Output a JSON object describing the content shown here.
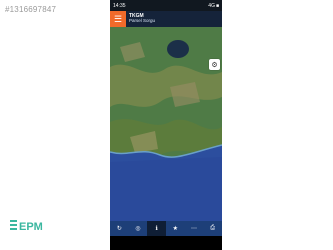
{
  "watermark": {
    "id_text": "#1316697847"
  },
  "logo": {
    "text": "EPM"
  },
  "status_bar": {
    "time": "14:35",
    "right": "4G",
    "battery": "■"
  },
  "app_bar": {
    "menu_icon": "menu-icon",
    "title": "TKGM",
    "subtitle": "Parsel Sorgu"
  },
  "map": {
    "layers_icon": "layers-icon",
    "colors": {
      "land": "#4f7b46",
      "sea": "#2c4e9e",
      "lake": "#1b2f48"
    }
  },
  "bottom_nav": {
    "items": [
      {
        "icon": "refresh-icon",
        "glyph": "↻"
      },
      {
        "icon": "location-icon",
        "glyph": "◎"
      },
      {
        "icon": "info-icon",
        "glyph": "ℹ"
      },
      {
        "icon": "star-icon",
        "glyph": "★"
      },
      {
        "icon": "ruler-icon",
        "glyph": "⋯"
      },
      {
        "icon": "print-icon",
        "glyph": "⎙"
      }
    ]
  }
}
